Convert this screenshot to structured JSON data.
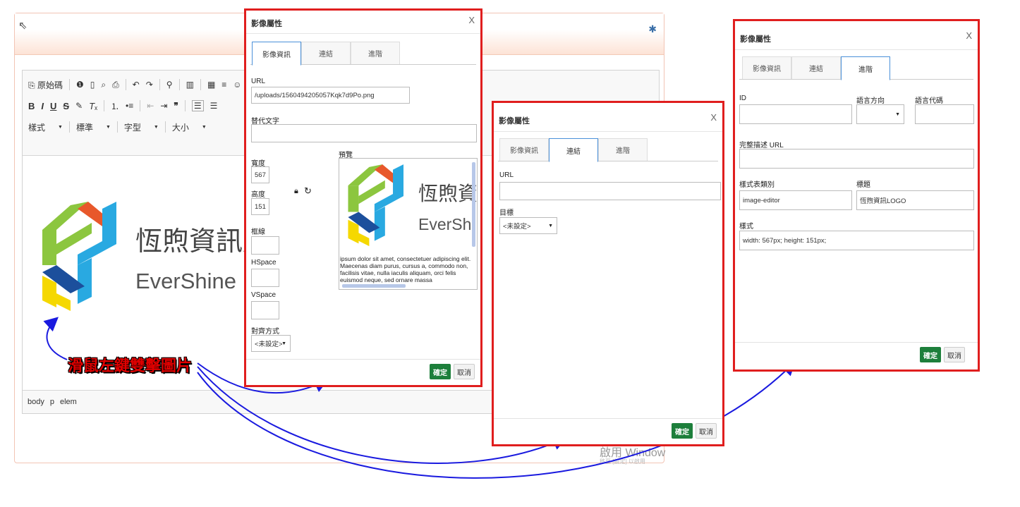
{
  "editor": {
    "toolbar_row1": {
      "source_label": "原始碼"
    },
    "toolbar_row2": {
      "bold": "B",
      "italic": "I",
      "underline": "U",
      "strike": "S",
      "quote": "❞"
    },
    "toolbar_row3": {
      "style": "樣式",
      "format": "標準",
      "font": "字型",
      "size": "大小"
    },
    "path_items": [
      "body",
      "p",
      "elem"
    ],
    "logo_cn": "恆煦資訊股份",
    "logo_en": "EverShine Int"
  },
  "watermark": {
    "line1": "啟用 Window",
    "line2": "移至 [設定] 以啟用"
  },
  "annotation": "滑鼠左鍵雙擊圖片",
  "dialog1": {
    "title": "影像屬性",
    "close": "X",
    "tabs": [
      "影像資訊",
      "連結",
      "進階"
    ],
    "url_label": "URL",
    "url_value": "/uploads/1560494205057Kqk7d9Po.png",
    "alt_label": "替代文字",
    "width_label": "寬度",
    "width_value": "567",
    "height_label": "高度",
    "height_value": "151",
    "border_label": "框線",
    "hspace_label": "HSpace",
    "vspace_label": "VSpace",
    "align_label": "對齊方式",
    "align_value": "<未設定>",
    "preview_label": "預覽",
    "preview_logo_cn": "恆煦資",
    "preview_logo_en": "EverShi",
    "preview_text": "ipsum dolor sit amet, consectetuer adipiscing elit. Maecenas diam purus, cursus a, commodo non, facilisis vitae, nulla iaculis aliquam, orci felis euismod neque, sed ornare massa",
    "ok": "確定",
    "cancel": "取消"
  },
  "dialog2": {
    "title": "影像屬性",
    "close": "X",
    "tabs": [
      "影像資訊",
      "連結",
      "進階"
    ],
    "url_label": "URL",
    "target_label": "目標",
    "target_value": "<未設定>",
    "ok": "確定",
    "cancel": "取消"
  },
  "dialog3": {
    "title": "影像屬性",
    "close": "X",
    "tabs": [
      "影像資訊",
      "連結",
      "進階"
    ],
    "id_label": "ID",
    "dir_label": "語言方向",
    "lang_label": "語言代碼",
    "longdesc_label": "完整描述 URL",
    "class_label": "樣式表類別",
    "class_value": "image-editor",
    "title_label": "標題",
    "title_value": "恆煦資訊LOGO",
    "style_label": "樣式",
    "style_value": "width: 567px; height: 151px;",
    "ok": "確定",
    "cancel": "取消"
  },
  "colors": {
    "frame_red": "#e01e1e",
    "ok_green": "#1d7f3b",
    "arrow_blue": "#1a1adf",
    "tab_blue": "#4a90d9"
  }
}
